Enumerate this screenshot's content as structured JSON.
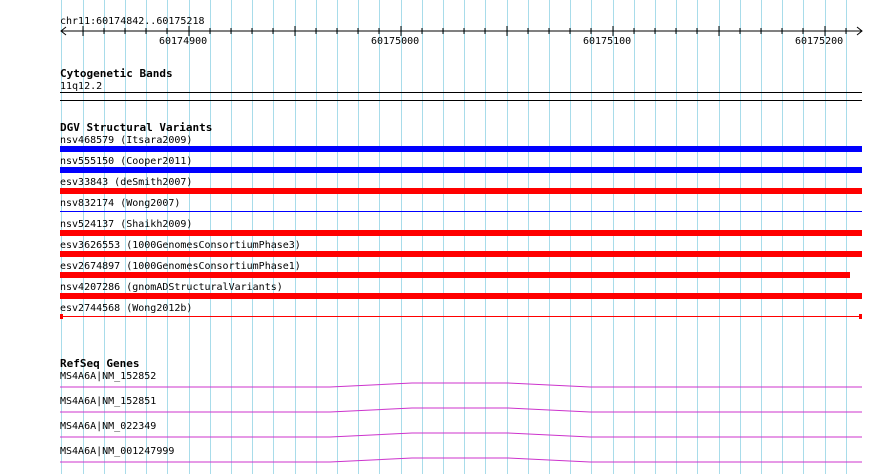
{
  "ruler": {
    "region_label": "chr11:60174842..60175218",
    "ticks": [
      "60174900",
      "60175000",
      "60175100",
      "60175200"
    ]
  },
  "cytoband": {
    "title": "Cytogenetic Bands",
    "band_label": "11q12.2"
  },
  "dgv": {
    "title": "DGV Structural Variants",
    "variants": [
      {
        "label": "nsv468579 (Itsara2009)",
        "color": "#0000ff",
        "style": "thick"
      },
      {
        "label": "nsv555150 (Cooper2011)",
        "color": "#0000ff",
        "style": "thick"
      },
      {
        "label": "esv33843 (deSmith2007)",
        "color": "#ff0000",
        "style": "thick"
      },
      {
        "label": "nsv832174 (Wong2007)",
        "color": "#0000ff",
        "style": "thin"
      },
      {
        "label": "nsv524137 (Shaikh2009)",
        "color": "#ff0000",
        "style": "thick"
      },
      {
        "label": "esv3626553 (1000GenomesConsortiumPhase3)",
        "color": "#ff0000",
        "style": "thick"
      },
      {
        "label": "esv2674897 (1000GenomesConsortiumPhase1)",
        "color": "#ff0000",
        "style": "thick-short"
      },
      {
        "label": "nsv4207286 (gnomADStructuralVariants)",
        "color": "#ff0000",
        "style": "thick"
      },
      {
        "label": "esv2744568 (Wong2012b)",
        "color": "#ff0000",
        "style": "thin-capped"
      }
    ]
  },
  "refseq": {
    "title": "RefSeq Genes",
    "genes": [
      {
        "label": "MS4A6A|NM_152852",
        "color": "#cc33cc"
      },
      {
        "label": "MS4A6A|NM_152851",
        "color": "#cc33cc"
      },
      {
        "label": "MS4A6A|NM_022349",
        "color": "#cc33cc"
      },
      {
        "label": "MS4A6A|NM_001247999",
        "color": "#cc33cc"
      }
    ]
  },
  "colors": {
    "grid_major": "#a8dcea",
    "grid_minor": "#d8eff6",
    "text": "#000000"
  }
}
